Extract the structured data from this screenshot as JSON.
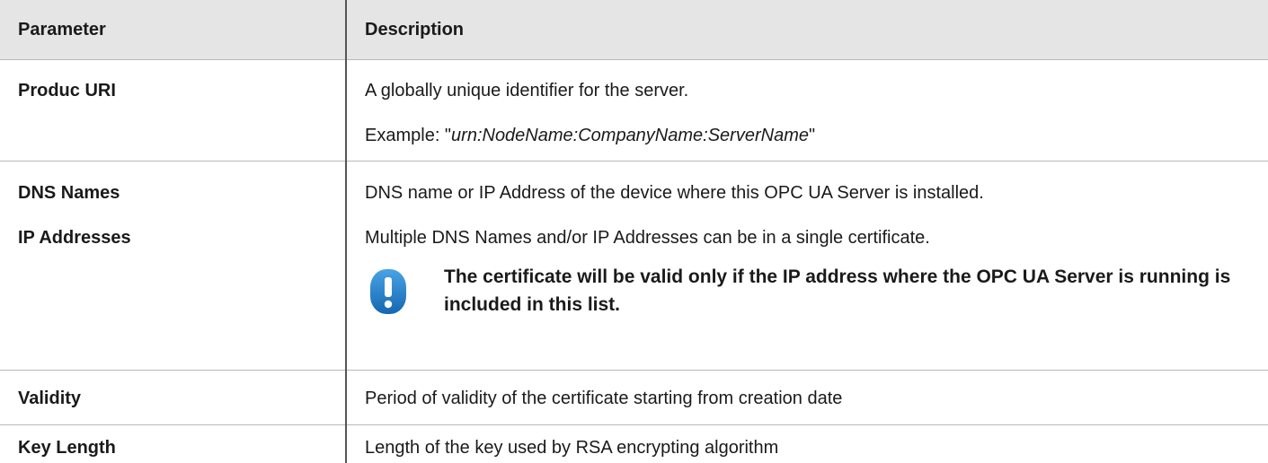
{
  "table": {
    "headers": {
      "parameter": "Parameter",
      "description": "Description"
    },
    "rows": [
      {
        "params": [
          "Produc URI"
        ],
        "desc": [
          "A globally unique identifier for the server.",
          {
            "prefix": "Example: \"",
            "em": "urn:NodeName:CompanyName:ServerName",
            "suffix": "\""
          }
        ]
      },
      {
        "params": [
          "DNS Names",
          "IP Addresses"
        ],
        "desc": [
          "DNS name or IP Address of the device where this OPC UA Server is installed.",
          "Multiple DNS Names and/or IP Addresses can be in a single certificate."
        ],
        "note": {
          "icon": "exclamation-icon",
          "text": "The certificate will be valid only if the IP address where the OPC UA Server is running is included in this list."
        }
      },
      {
        "params": [
          "Validity"
        ],
        "desc": [
          "Period of validity of the certificate starting from creation date"
        ]
      },
      {
        "params": [
          "Key Length"
        ],
        "desc": [
          "Length of the key used by RSA encrypting algorithm"
        ]
      }
    ]
  },
  "colors": {
    "header_bg": "#e5e5e5",
    "icon_blue": "#1f7bc4",
    "divider": "#555555"
  }
}
